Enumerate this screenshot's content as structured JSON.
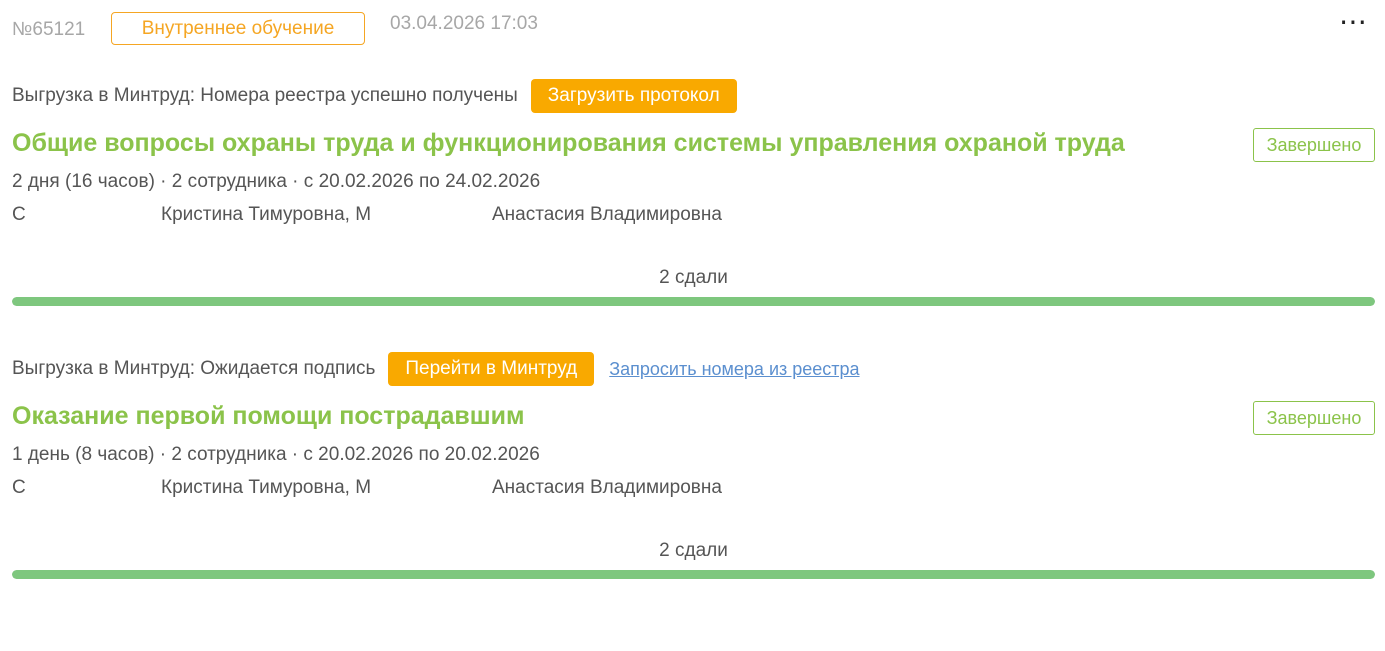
{
  "header": {
    "order_number": "№65121",
    "type_badge": "Внутреннее обучение",
    "created_at": "03.04.2026 17:03",
    "more_label": "⋯"
  },
  "courses": [
    {
      "export_status": "Выгрузка в Минтруд: Номера реестра успешно получены",
      "action_label": "Загрузить протокол",
      "link_label": "",
      "title": "Общие вопросы охраны труда и функционирования системы управления охраной труда",
      "status": "Завершено",
      "meta": "2 дня (16 часов) · 2 сотрудника · с 20.02.2026 по 24.02.2026",
      "participants": [
        "С",
        "Кристина Тимуровна, М",
        "Анастасия Владимировна"
      ],
      "passed_label": "2 сдали",
      "progress": 1.0
    },
    {
      "export_status": "Выгрузка в Минтруд: Ожидается подпись",
      "action_label": "Перейти в Минтруд",
      "link_label": "Запросить номера из реестра",
      "title": "Оказание первой помощи пострадавшим",
      "status": "Завершено",
      "meta": "1 день (8 часов) · 2 сотрудника · с 20.02.2026 по 20.02.2026",
      "participants": [
        "С",
        "Кристина Тимуровна, М",
        "Анастасия Владимировна"
      ],
      "passed_label": "2 сдали",
      "progress": 1.0
    }
  ],
  "colors": {
    "accent_orange": "#f9a900",
    "title_green": "#8bc34a",
    "progress_green": "#7ec77e",
    "link_blue": "#5b8fcf"
  }
}
